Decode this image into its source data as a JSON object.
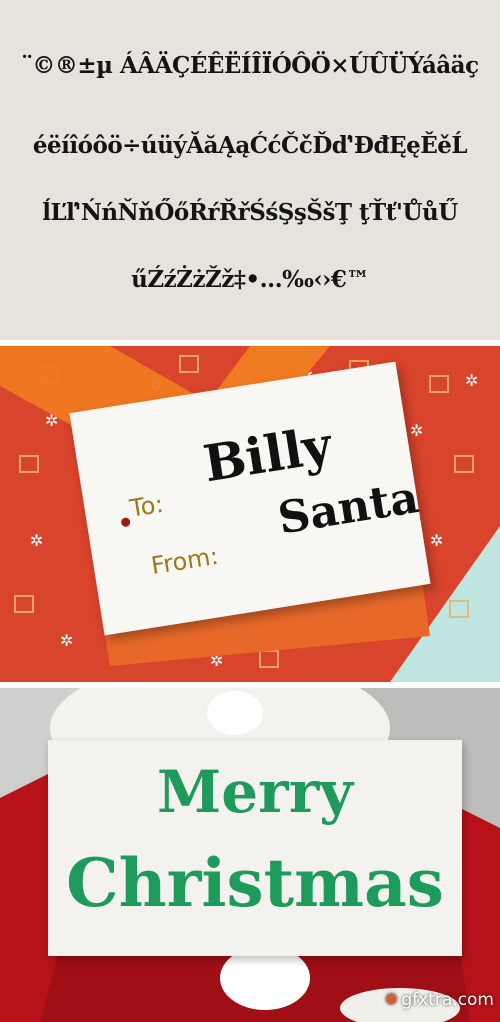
{
  "specimen": {
    "lines": [
      "¨©®±µ ÁÂÄÇÉÊËÍÎÏÓÔÖ×ÚÛÜÝáâäç",
      "éëíîóôö÷úüýĂăĄąĆćČčĎď'ĐđĘęĚěĹ",
      "ĺĽľ'ŃńŇňŐőŔŕŘřŚśŞşŠšŢ ţŤť'ŮůŰ",
      "űŹźŻżŽž‡•...‰‹›€™"
    ]
  },
  "gift_tag": {
    "to_label": "To:",
    "to_name": "Billy",
    "from_label": "From:",
    "from_name": "Santa"
  },
  "sign": {
    "line1": "Merry",
    "line2": "Christmas"
  },
  "watermark": {
    "icon": "gear-icon",
    "text": "gfxtra.com"
  },
  "colors": {
    "specimen_bg": "#e6e3dd",
    "gift_red": "#d9442c",
    "ribbon_orange": "#f07a22",
    "tag_gold": "#9a7a1e",
    "sign_green": "#1e9a5a",
    "santa_red": "#b7121a"
  }
}
